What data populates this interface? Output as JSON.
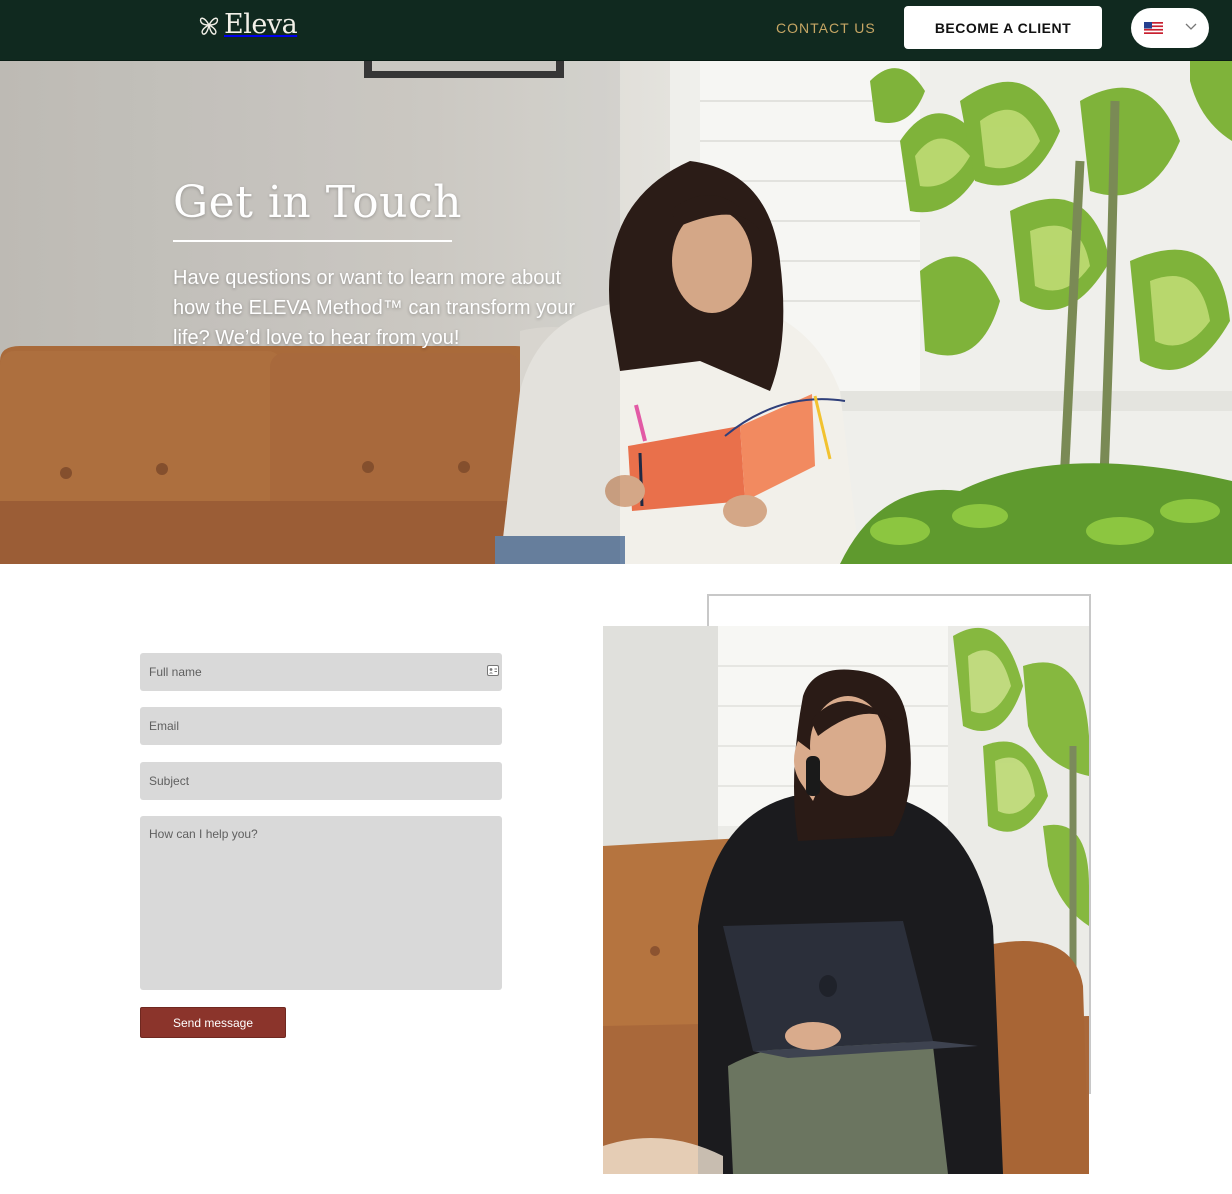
{
  "header": {
    "brand": "Eleva",
    "contact_label": "CONTACT US",
    "cta_label": "BECOME A CLIENT",
    "language": {
      "icon": "us-flag-icon",
      "chevron": "chevron-down-icon"
    }
  },
  "hero": {
    "title": "Get in Touch",
    "body": "Have questions or want to learn more about how the ELEVA Method™ can transform your life? We’d love to hear from you!"
  },
  "form": {
    "full_name_placeholder": "Full name",
    "email_placeholder": "Email",
    "subject_placeholder": "Subject",
    "message_placeholder": "How can I help you?",
    "submit_label": "Send message"
  },
  "colors": {
    "header_bg": "#10291f",
    "accent_gold": "#c6a664",
    "button_red": "#8b342b",
    "field_bg": "#d9d9d9"
  }
}
